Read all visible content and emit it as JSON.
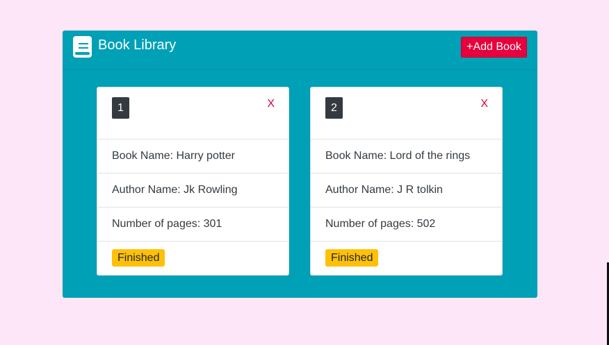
{
  "header": {
    "title": "Book Library",
    "add_button_label": "+Add Book",
    "logo_icon": "book-icon"
  },
  "books": [
    {
      "index": "1",
      "close_label": "X",
      "book_name": "Book Name: Harry potter",
      "author_name": "Author Name: Jk Rowling",
      "pages": "Number of pages: 301",
      "status": "Finished"
    },
    {
      "index": "2",
      "close_label": "X",
      "book_name": "Book Name: Lord of the rings",
      "author_name": "Author Name: J R tolkin",
      "pages": "Number of pages: 502",
      "status": "Finished"
    }
  ],
  "colors": {
    "page_background": "#fde6f7",
    "panel": "#00a0b7",
    "add_button": "#e8003c",
    "badge": "#343a40",
    "status": "#ffc107"
  }
}
